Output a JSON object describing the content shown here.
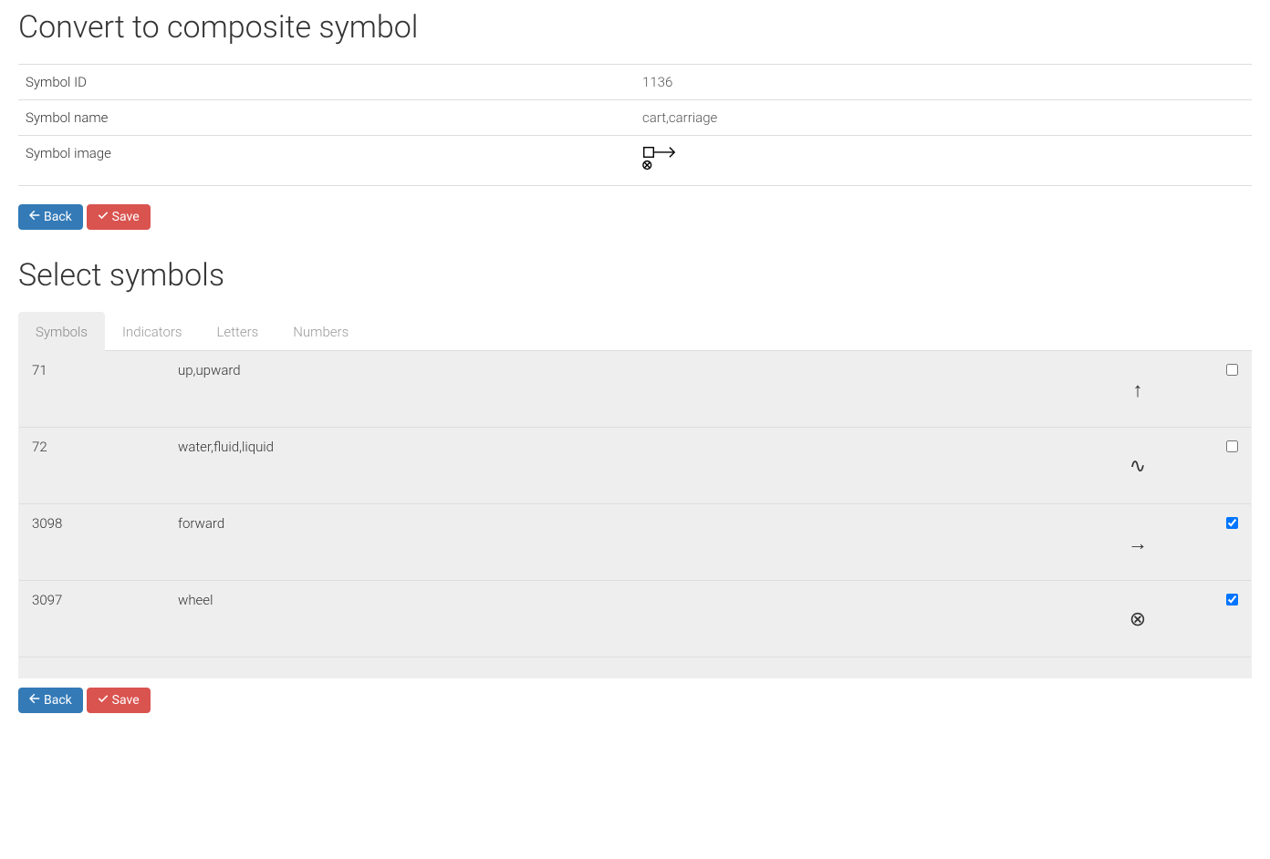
{
  "header": {
    "title": "Convert to composite symbol"
  },
  "info": {
    "id_label": "Symbol ID",
    "id_value": "1136",
    "name_label": "Symbol name",
    "name_value": "cart,carriage",
    "image_label": "Symbol image"
  },
  "buttons": {
    "back": "Back",
    "save": "Save"
  },
  "select_header": "Select symbols",
  "tabs": [
    "Symbols",
    "Indicators",
    "Letters",
    "Numbers"
  ],
  "active_tab": 0,
  "symbols": [
    {
      "id": "71",
      "name": "up,upward",
      "glyph": "↑",
      "checked": false
    },
    {
      "id": "72",
      "name": "water,fluid,liquid",
      "glyph": "∿",
      "checked": false
    },
    {
      "id": "3098",
      "name": "forward",
      "glyph": "→",
      "checked": true
    },
    {
      "id": "3097",
      "name": "wheel",
      "glyph": "⊗",
      "checked": true
    }
  ]
}
